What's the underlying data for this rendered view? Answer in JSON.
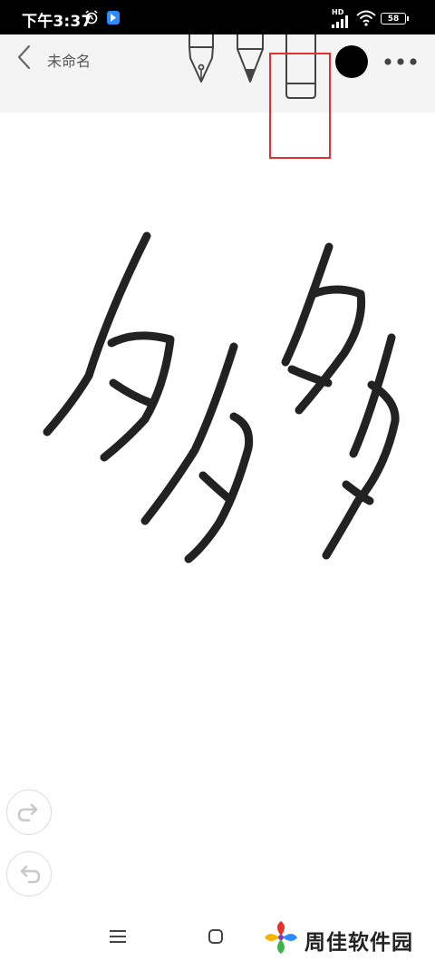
{
  "status_bar": {
    "time": "下午3:37",
    "network_label": "HD",
    "battery": "58",
    "icons": [
      "alarm-icon",
      "app-notification-icon",
      "signal-icon",
      "wifi-icon",
      "battery-icon"
    ]
  },
  "toolbar": {
    "title": "未命名",
    "tools": [
      "fountain-pen-icon",
      "pen-icon",
      "eraser-icon"
    ],
    "selected_tool": "eraser",
    "current_color": "#000000",
    "highlight_color": "#e53030"
  },
  "canvas": {
    "background": "#ffffff",
    "stroke_color": "#222222"
  },
  "controls": {
    "redo_icon": "redo-icon",
    "undo_icon": "undo-icon"
  },
  "nav_bar": {
    "menu_glyph": "☰",
    "icons": [
      "menu-icon",
      "home-icon"
    ]
  },
  "watermark": {
    "text": "周佳软件园"
  }
}
